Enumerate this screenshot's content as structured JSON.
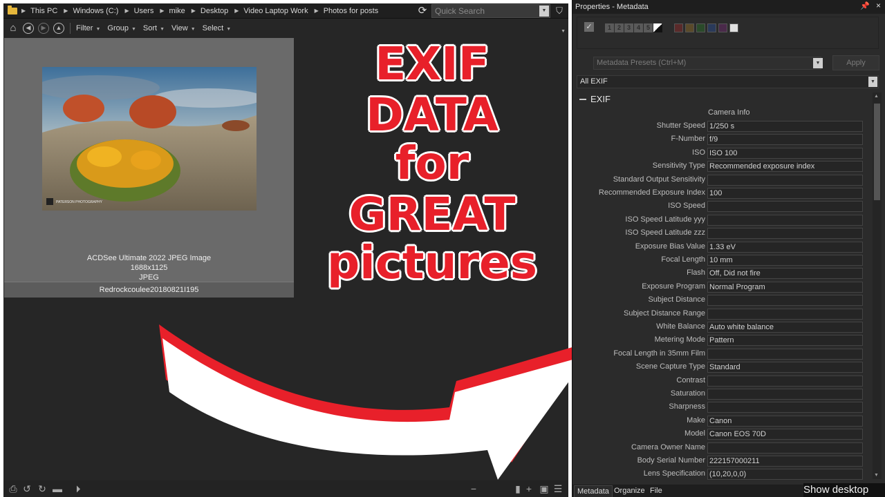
{
  "breadcrumb": [
    "This PC",
    "Windows (C:)",
    "Users",
    "mike",
    "Desktop",
    "Video Laptop Work",
    "Photos for posts"
  ],
  "search": {
    "placeholder": "Quick Search"
  },
  "toolbar": {
    "menus": [
      "Filter",
      "Group",
      "Sort",
      "View",
      "Select"
    ]
  },
  "thumbnail": {
    "type_label": "ACDSee Ultimate 2022 JPEG Image",
    "dimensions": "1688x1125",
    "format": "JPEG",
    "filename": "Redrockcoulee20180821I195",
    "watermark": "PATERSON PHOTOGRAPHY"
  },
  "overlay": {
    "lines": [
      "EXIF",
      "DATA",
      "for",
      "GREAT",
      "pictures"
    ]
  },
  "properties": {
    "title": "Properties - Metadata",
    "ratings": [
      "1",
      "2",
      "3",
      "4",
      "5"
    ],
    "presets_placeholder": "Metadata Presets (Ctrl+M)",
    "apply_label": "Apply",
    "view_select": "All EXIF",
    "section": "EXIF",
    "subheading": "Camera Info",
    "fields": [
      {
        "label": "Shutter Speed",
        "value": "1/250 s"
      },
      {
        "label": "F-Number",
        "value": "f/9"
      },
      {
        "label": "ISO",
        "value": "ISO 100"
      },
      {
        "label": "Sensitivity Type",
        "value": "Recommended exposure index"
      },
      {
        "label": "Standard Output Sensitivity",
        "value": ""
      },
      {
        "label": "Recommended Exposure Index",
        "value": "100"
      },
      {
        "label": "ISO Speed",
        "value": ""
      },
      {
        "label": "ISO Speed Latitude yyy",
        "value": ""
      },
      {
        "label": "ISO Speed Latitude zzz",
        "value": ""
      },
      {
        "label": "Exposure Bias Value",
        "value": "1.33 eV"
      },
      {
        "label": "Focal Length",
        "value": "10 mm"
      },
      {
        "label": "Flash",
        "value": "Off, Did not fire"
      },
      {
        "label": "Exposure Program",
        "value": "Normal Program"
      },
      {
        "label": "Subject Distance",
        "value": ""
      },
      {
        "label": "Subject Distance Range",
        "value": ""
      },
      {
        "label": "White Balance",
        "value": "Auto white balance"
      },
      {
        "label": "Metering Mode",
        "value": "Pattern"
      },
      {
        "label": "Focal Length in 35mm Film",
        "value": ""
      },
      {
        "label": "Scene Capture Type",
        "value": "Standard"
      },
      {
        "label": "Contrast",
        "value": ""
      },
      {
        "label": "Saturation",
        "value": ""
      },
      {
        "label": "Sharpness",
        "value": ""
      },
      {
        "label": "Make",
        "value": "Canon"
      },
      {
        "label": "Model",
        "value": "Canon EOS 70D"
      },
      {
        "label": "Camera Owner Name",
        "value": ""
      },
      {
        "label": "Body Serial Number",
        "value": "222157000211"
      },
      {
        "label": "Lens Specification",
        "value": "(10,20,0,0)"
      }
    ],
    "tabs": [
      "Metadata",
      "Organize",
      "File"
    ]
  },
  "taskbar": {
    "show_desktop": "Show desktop"
  },
  "colors": {
    "accent_red": "#e8202a",
    "panel_bg": "#2b2b2b",
    "folder": "#e6b73c"
  },
  "icons": [
    "folder-icon",
    "refresh-icon",
    "filter-icon",
    "home-icon",
    "back-icon",
    "forward-icon",
    "up-icon",
    "pin-icon",
    "close-icon"
  ]
}
